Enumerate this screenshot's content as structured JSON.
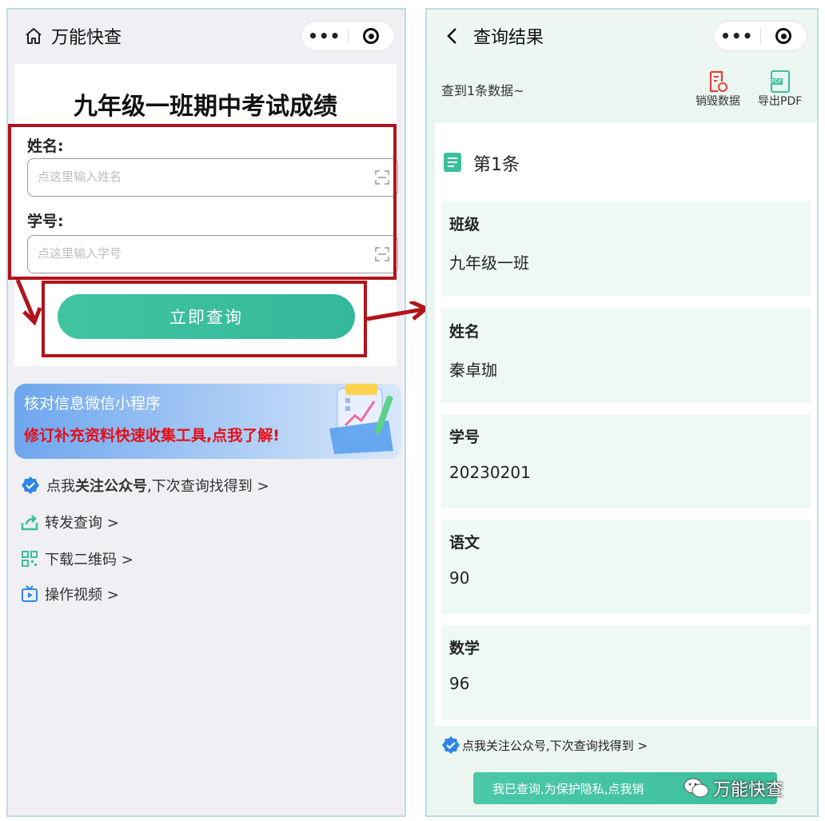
{
  "left": {
    "nav_title": "万能快查",
    "capsule_menu": "•••",
    "form": {
      "title": "九年级一班期中考试成绩",
      "name_label": "姓名:",
      "name_placeholder": "点这里输入姓名",
      "id_label": "学号:",
      "id_placeholder": "点这里输入学号",
      "query_button": "立即查询"
    },
    "banner": {
      "title": "核对信息微信小程序",
      "subtitle": "修订补充资料快速收集工具,点我了解!"
    },
    "links": {
      "follow_prefix": "点我",
      "follow_bold": "关注公众号",
      "follow_suffix": ",下次查询找得到 >",
      "share": "转发查询 >",
      "qrcode": "下载二维码 >",
      "video": "操作视频 >"
    }
  },
  "right": {
    "nav_title": "查询结果",
    "capsule_menu": "•••",
    "result_count": "查到1条数据~",
    "tools": {
      "destroy": "销毁数据",
      "export": "导出PDF",
      "pdf_badge": "PDF"
    },
    "record_title": "第1条",
    "fields": [
      {
        "label": "班级",
        "value": "九年级一班"
      },
      {
        "label": "姓名",
        "value": "秦卓珈"
      },
      {
        "label": "学号",
        "value": "20230201"
      },
      {
        "label": "语文",
        "value": "90"
      },
      {
        "label": "数学",
        "value": "96"
      }
    ],
    "follow": "点我关注公众号,下次查询找得到 >",
    "privacy_button": "我已查询,为保护隐私,点我销",
    "watermark": "万能快查"
  },
  "colors": {
    "accent": "#3cbf9c",
    "annotation_red": "#b0141a",
    "banner_red": "#e3101a",
    "verified_blue": "#2f86e6"
  }
}
